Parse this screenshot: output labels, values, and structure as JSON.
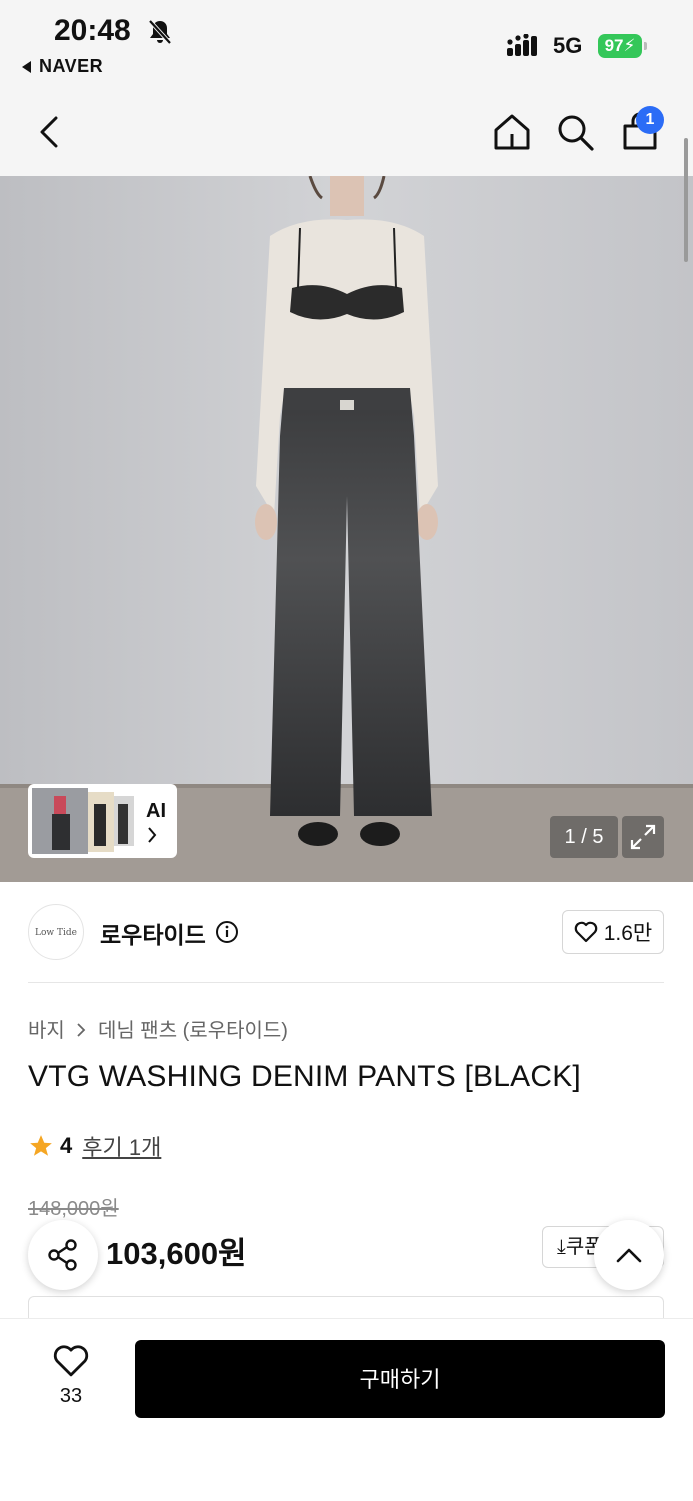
{
  "status_bar": {
    "time": "20:48",
    "back_app": "NAVER",
    "network": "5G",
    "battery": "97"
  },
  "nav": {
    "cart_count": "1",
    "icons": [
      "back-icon",
      "home-icon",
      "search-icon",
      "cart-icon"
    ]
  },
  "gallery": {
    "ai_label": "AI",
    "counter": "1 / 5"
  },
  "brand": {
    "logo_text": "Low Tide",
    "name": "로우타이드",
    "likes": "1.6만"
  },
  "breadcrumb": {
    "category": "바지",
    "sub": "데님 팬츠 (로우타이드)"
  },
  "product": {
    "title": "VTG WASHING DENIM PANTS [BLACK]",
    "rating": "4",
    "review_link": "후기 1개",
    "original_price": "148,000원",
    "price": "103,600원",
    "coupon_label": "쿠폰"
  },
  "bottom_bar": {
    "wish_count": "33",
    "buy_label": "구매하기"
  },
  "colors": {
    "accent_badge": "#2b6cf6",
    "battery": "#34c759",
    "star": "#f5a623",
    "buy_button": "#000000"
  }
}
